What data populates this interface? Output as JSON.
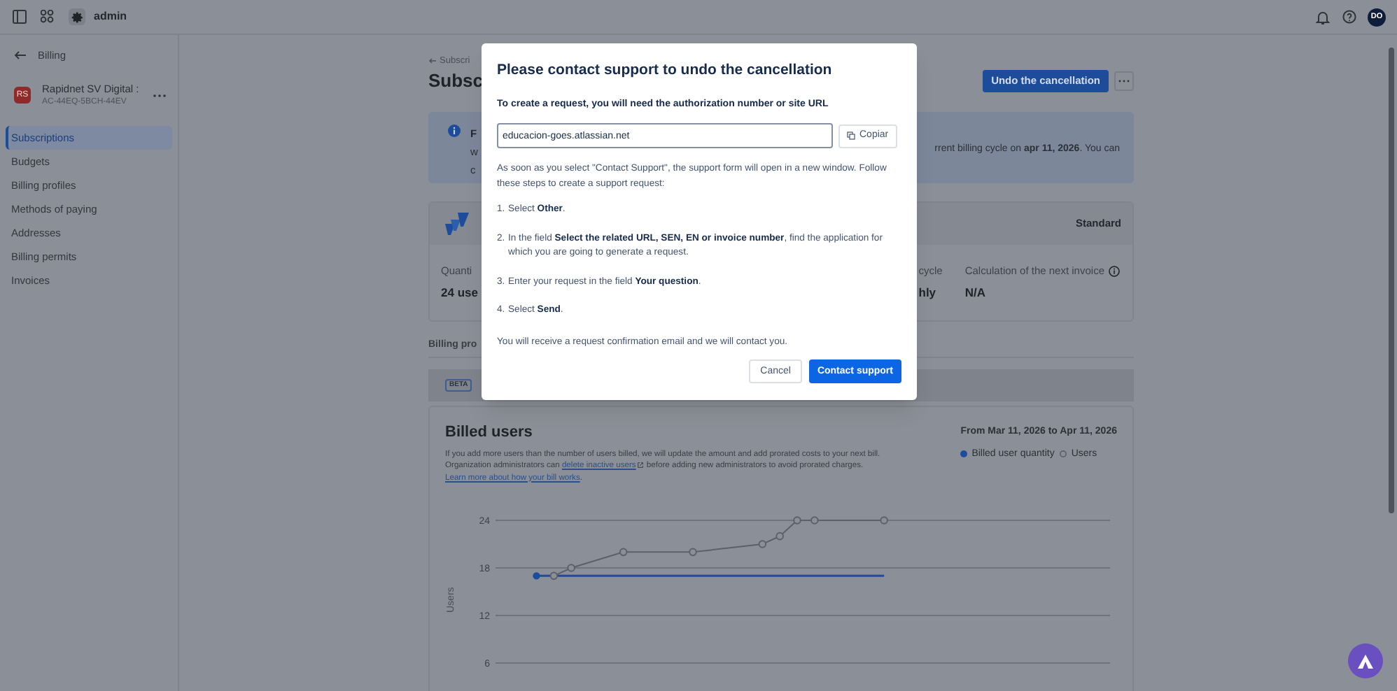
{
  "top_bar": {
    "workspace": "admin",
    "avatar": "DO"
  },
  "sidebar": {
    "back_label": "Billing",
    "org": {
      "initials": "RS",
      "name": "Rapidnet SV Digital :",
      "id": "AC-44EQ-5BCH-44EV"
    },
    "items": [
      {
        "label": "Subscriptions",
        "selected": true
      },
      {
        "label": "Budgets",
        "selected": false
      },
      {
        "label": "Billing profiles",
        "selected": false
      },
      {
        "label": "Methods of paying",
        "selected": false
      },
      {
        "label": "Addresses",
        "selected": false
      },
      {
        "label": "Billing permits",
        "selected": false
      },
      {
        "label": "Invoices",
        "selected": false
      }
    ]
  },
  "page": {
    "breadcrumb": "Subscri",
    "title": "Subsc",
    "primary_action": "Undo the cancellation",
    "banner": {
      "title": "F",
      "left_lines": [
        "w",
        "c"
      ],
      "text": "rrent billing cycle on **apr 11, 2026**. You can"
    },
    "plan": {
      "edition": "Standard",
      "stats_left": [
        {
          "label": "Quanti",
          "value": "24 use",
          "info": false
        }
      ],
      "stats_right": [
        {
          "label": "cycle",
          "value": "hly",
          "info": false
        },
        {
          "label": "Calculation of the next invoice",
          "value": "N/A",
          "info": true
        }
      ]
    },
    "section_heading": "Billing pro",
    "badge": "BETA",
    "billed_users": {
      "title": "Billed users",
      "period": "From Mar 11, 2026 to Apr 11, 2026",
      "description": [
        {
          "kind": "text",
          "text": "If you add more users than the number of users billed, we will update the amount and add prorated costs to your next bill. Organization administrators can "
        },
        {
          "kind": "link",
          "text": "delete inactive users",
          "external": true
        },
        {
          "kind": "text",
          "text": " before adding new administrators to avoid prorated charges. "
        },
        {
          "kind": "link",
          "text": "Learn more about how your bill works",
          "external": false
        },
        {
          "kind": "text",
          "text": "."
        }
      ],
      "chart_data": {
        "type": "line",
        "ylabel": "Users",
        "categories": [
          null,
          null,
          null,
          null,
          null,
          null,
          null,
          null,
          null,
          null,
          null,
          null,
          null,
          null,
          null,
          null,
          null,
          null,
          null,
          null,
          null,
          null,
          null,
          null,
          null,
          null,
          null,
          null,
          null,
          null,
          null,
          null,
          null,
          null,
          null,
          null,
          null
        ],
        "ylim": [
          6,
          24
        ],
        "yticks": [
          6,
          12,
          18,
          24
        ],
        "grid": true,
        "series": [
          {
            "name": "Billed user quantity",
            "color": "#1d4d9a",
            "marker": "none",
            "values": [
              null,
              null,
              null,
              17,
              17,
              17,
              17,
              17,
              17,
              17,
              17,
              17,
              17,
              17,
              17,
              17,
              17,
              17,
              17,
              17,
              17,
              17,
              17,
              17,
              null,
              null,
              null,
              null,
              null,
              null,
              null,
              null,
              null,
              null,
              null,
              null,
              null
            ]
          },
          {
            "name": "Users",
            "color": "#5d6068",
            "marker": "circle",
            "values": [
              null,
              null,
              null,
              null,
              17,
              18,
              null,
              null,
              20,
              null,
              null,
              null,
              20,
              null,
              null,
              null,
              21,
              22,
              24,
              24,
              null,
              null,
              null,
              24,
              null,
              null,
              null,
              null,
              null,
              null,
              null,
              null,
              null,
              null,
              null,
              null,
              null
            ]
          }
        ]
      }
    }
  },
  "dialog": {
    "title": "Please contact support to undo the cancellation",
    "instruction": "To create a request, you will need the authorization number or site URL",
    "site_url": "educacion-goes.atlassian.net",
    "copy_label": "Copiar",
    "intro": "As soon as you select \"Contact Support\", the support form will open in a new window. Follow these steps to create a support request:",
    "steps": [
      {
        "number": "1.",
        "text": "Select **Other**."
      },
      {
        "number": "2.",
        "text": "In the field **Select the related URL, SEN, EN or invoice number**, find the application for which you are going to generate a request."
      },
      {
        "number": "3.",
        "text": "Enter your request in the field **Your question**."
      },
      {
        "number": "4.",
        "text": "Select **Send**."
      }
    ],
    "note": "You will receive a request confirmation email and we will contact you.",
    "buttons": [
      {
        "label": "Cancel",
        "kind": "secondary"
      },
      {
        "label": "Contact support",
        "kind": "primary"
      }
    ]
  }
}
